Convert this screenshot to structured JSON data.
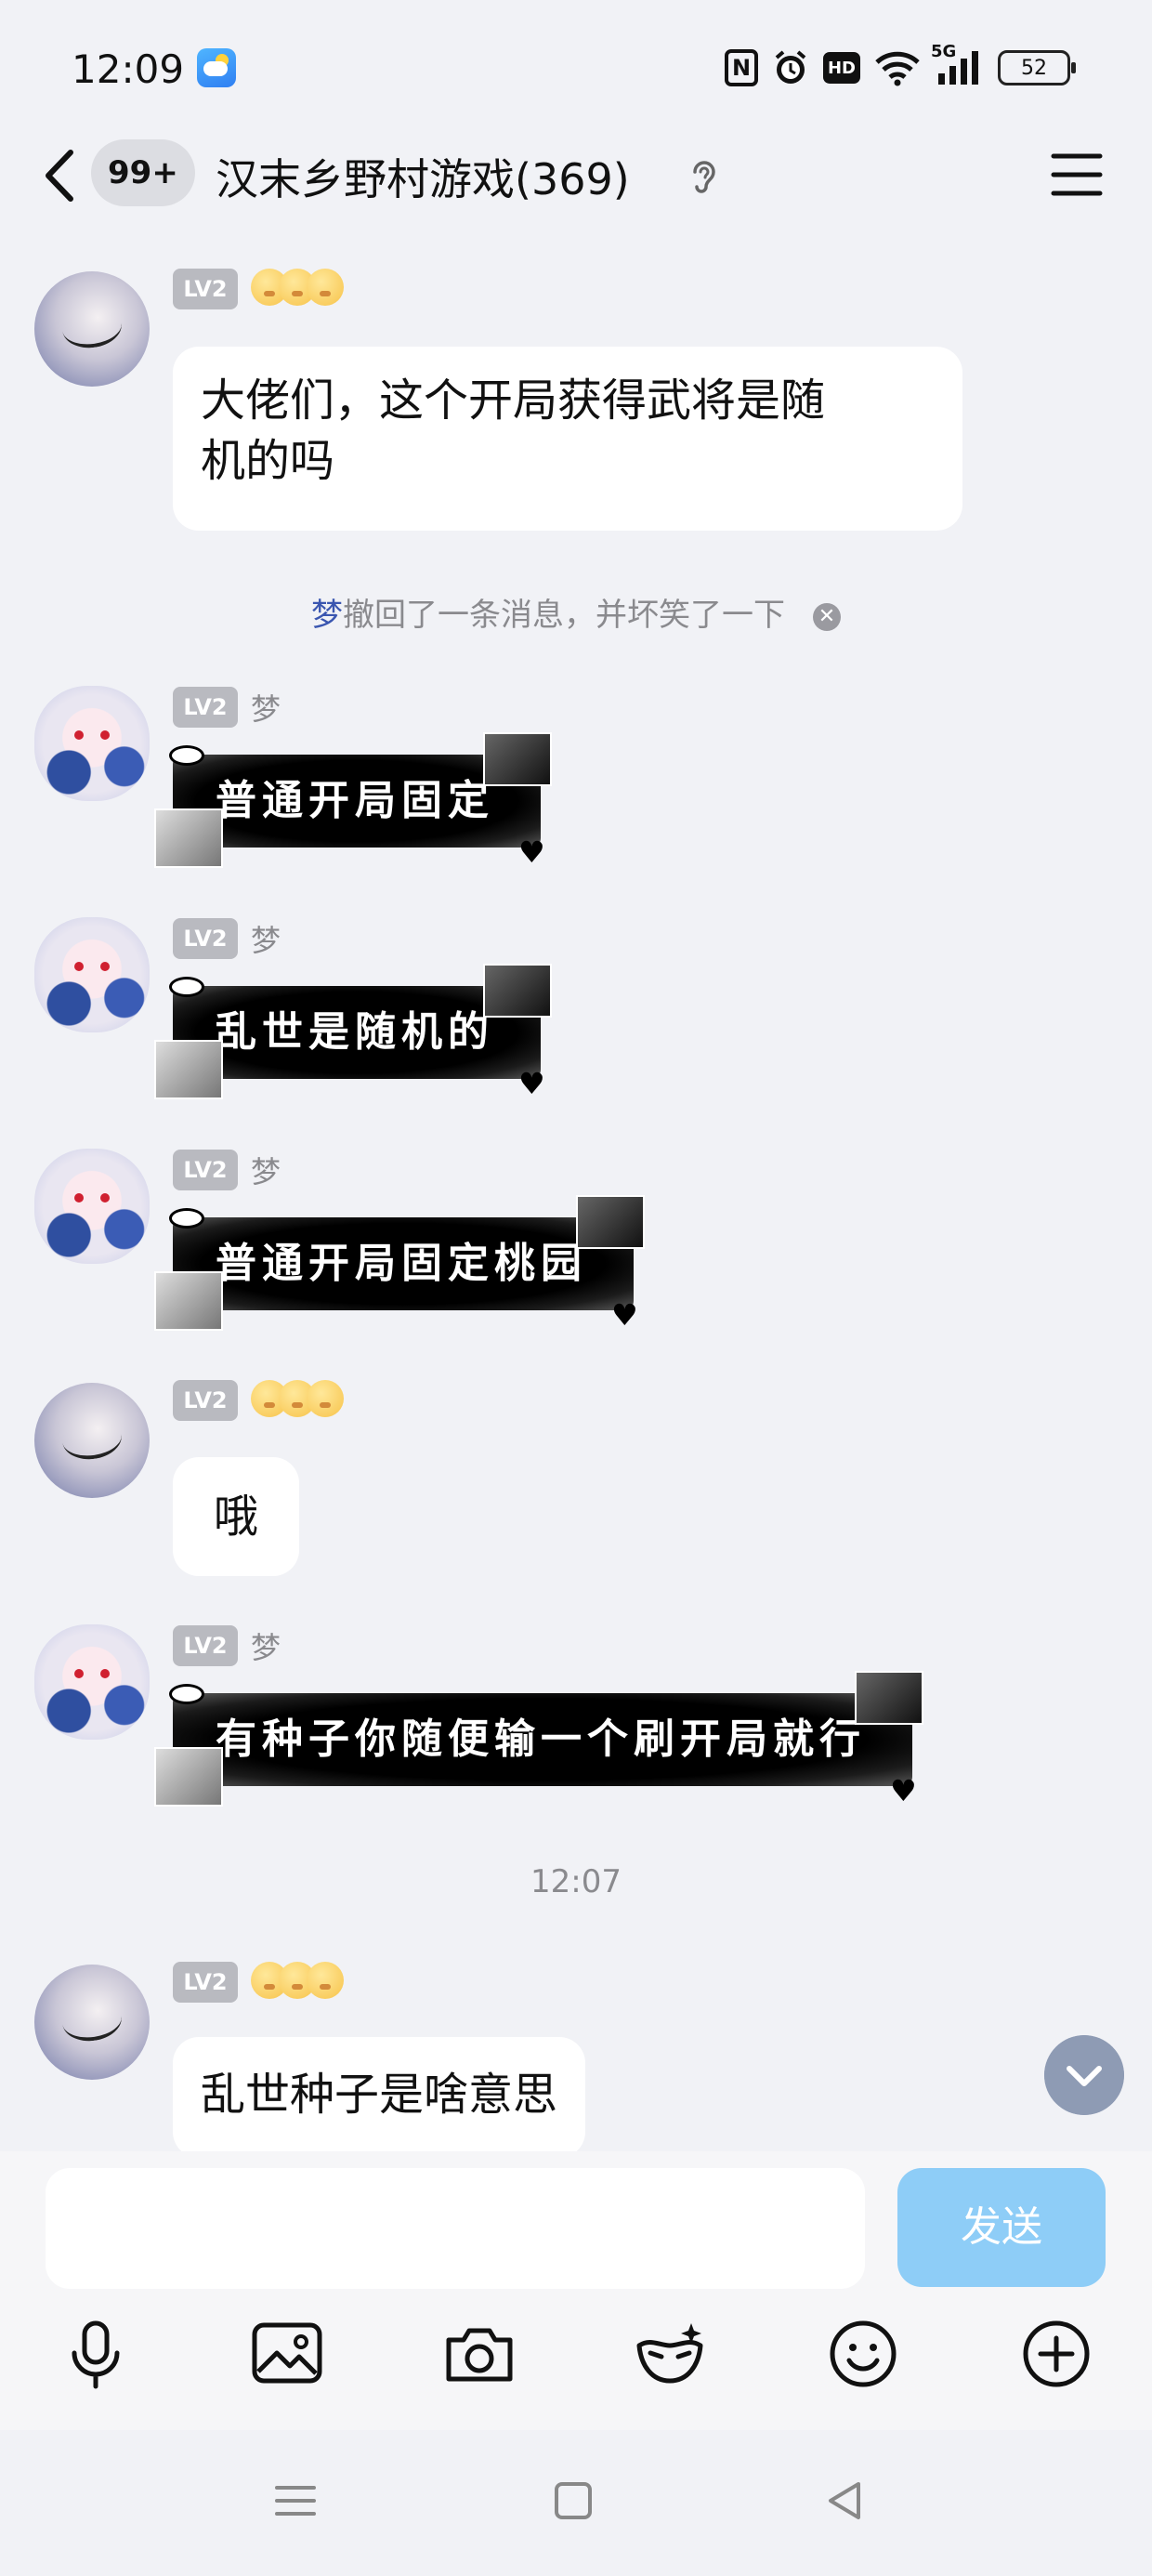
{
  "status_bar": {
    "time": "12:09",
    "network": "5G",
    "battery": "52",
    "icons": [
      "weather-icon",
      "nfc-icon",
      "alarm-icon",
      "hd-icon",
      "wifi-icon",
      "signal-icon",
      "battery-icon"
    ]
  },
  "header": {
    "unread_badge": "99+",
    "title": "汉末乡野村游戏(369)",
    "icons": [
      "back-icon",
      "ear-icon",
      "menu-icon"
    ]
  },
  "messages": [
    {
      "level": "LV2",
      "nickname": "",
      "text": "大佬们，这个开局获得武将是随机的吗",
      "line1": "大佬们，这个开局获得武将是随",
      "line2": "机的吗"
    },
    {
      "notice_who": "梦",
      "notice_text": "撤回了一条消息，并坏笑了一下"
    },
    {
      "level": "LV2",
      "nickname": "梦",
      "text": "普通开局固定"
    },
    {
      "level": "LV2",
      "nickname": "梦",
      "text": "乱世是随机的"
    },
    {
      "level": "LV2",
      "nickname": "梦",
      "text": "普通开局固定桃园"
    },
    {
      "level": "LV2",
      "nickname": "",
      "text": "哦"
    },
    {
      "level": "LV2",
      "nickname": "梦",
      "text": "有种子你随便输一个刷开局就行"
    },
    {
      "timestamp": "12:07"
    },
    {
      "level": "LV2",
      "nickname": "",
      "text": "乱世种子是啥意思"
    }
  ],
  "input": {
    "value": "",
    "send_label": "发送",
    "send_color": "#8ecdf7"
  },
  "toolbar": [
    "microphone-icon",
    "image-icon",
    "camera-icon",
    "face-mask-icon",
    "emoji-icon",
    "plus-icon"
  ],
  "navbar": [
    "menu-nav-icon",
    "home-nav-icon",
    "back-nav-icon"
  ]
}
